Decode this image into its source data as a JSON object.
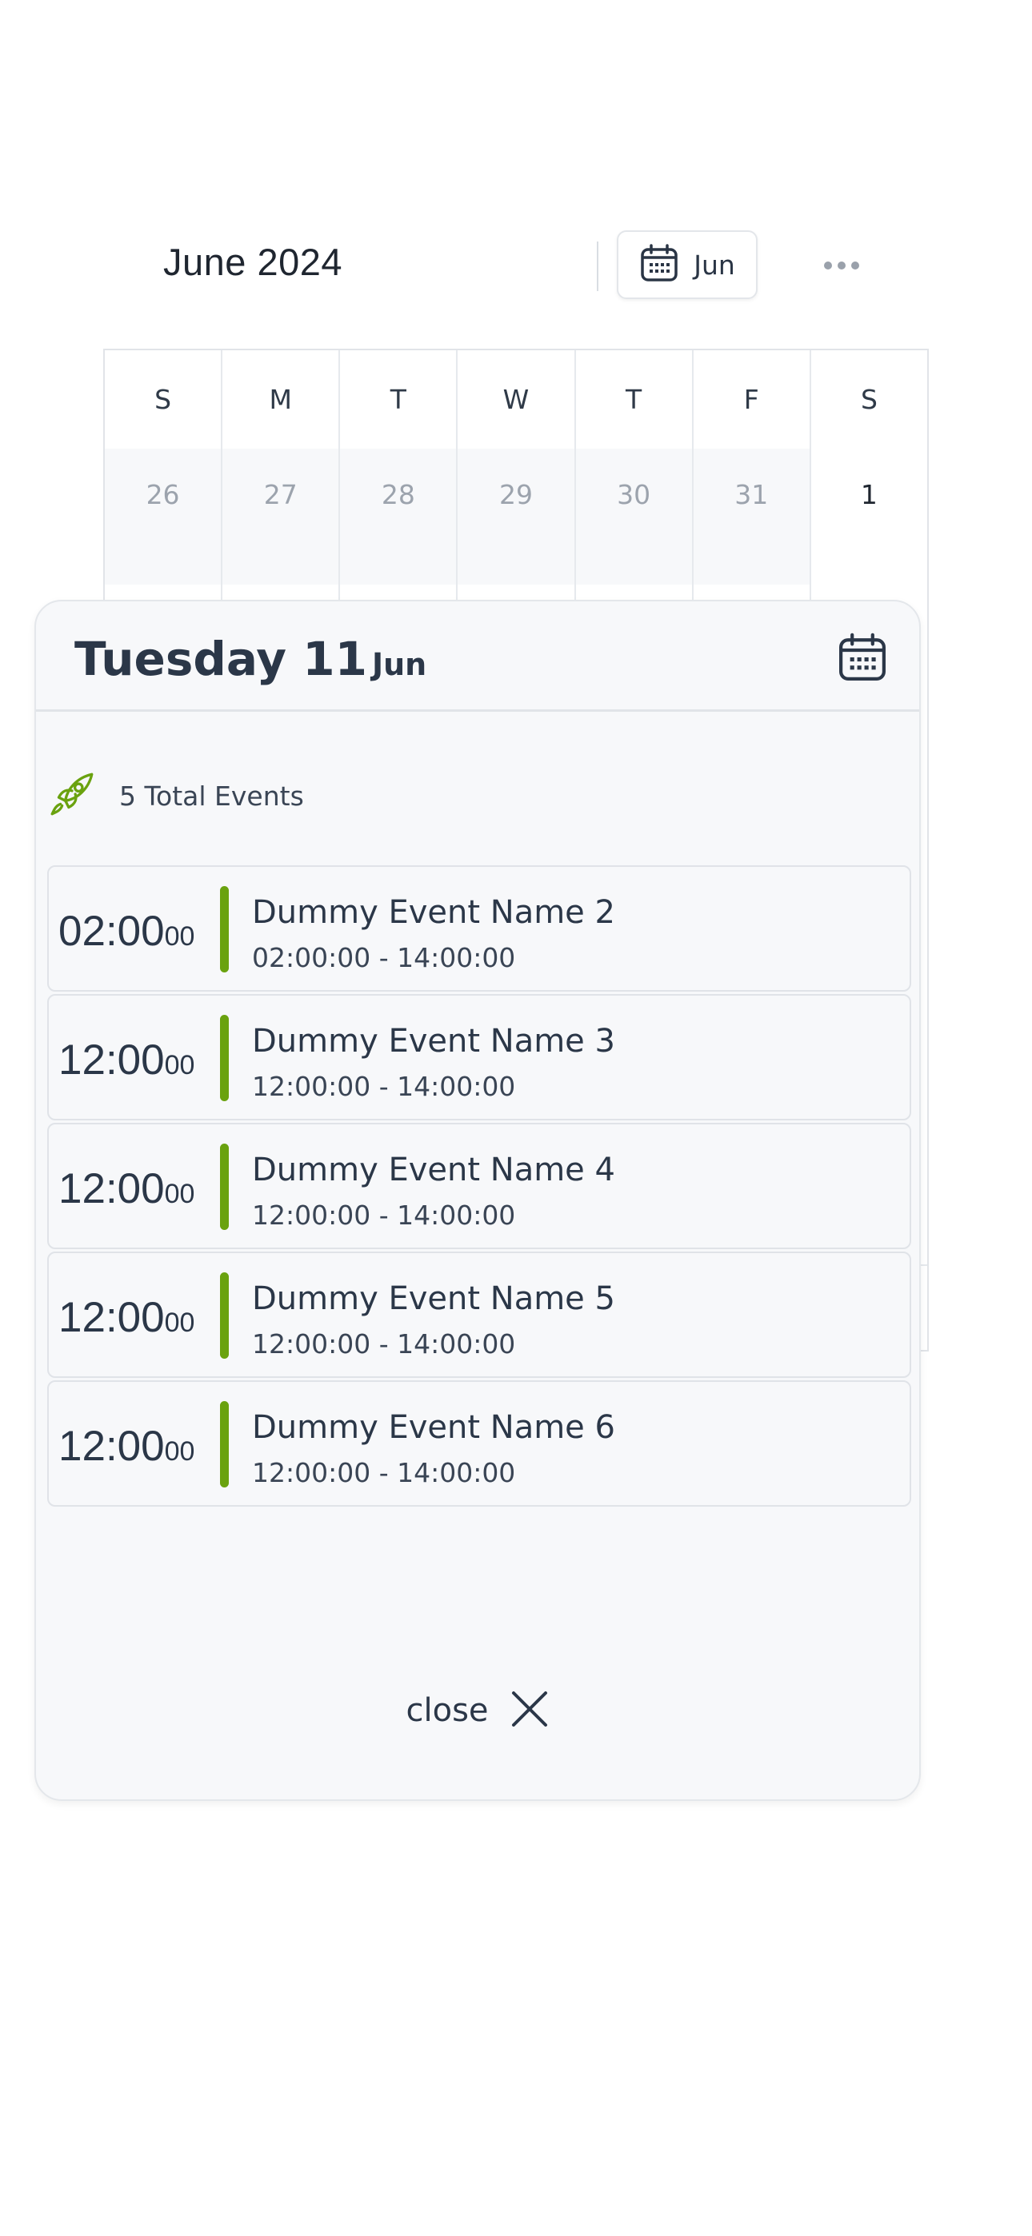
{
  "header": {
    "month_title": "June 2024",
    "view_button_label": "Jun",
    "more_icon": "more-horizontal-icon"
  },
  "calendar": {
    "weekdays": [
      "S",
      "M",
      "T",
      "W",
      "T",
      "F",
      "S"
    ],
    "first_week": [
      "26",
      "27",
      "28",
      "29",
      "30",
      "31",
      "1"
    ]
  },
  "modal": {
    "weekday_day": "Tuesday 11",
    "month": "Jun",
    "total_events": "5 Total Events",
    "events": [
      {
        "time_main": "02:00",
        "time_sec": "00",
        "name": "Dummy Event Name 2",
        "range": "02:00:00 - 14:00:00"
      },
      {
        "time_main": "12:00",
        "time_sec": "00",
        "name": "Dummy Event Name 3",
        "range": "12:00:00 - 14:00:00"
      },
      {
        "time_main": "12:00",
        "time_sec": "00",
        "name": "Dummy Event Name 4",
        "range": "12:00:00 - 14:00:00"
      },
      {
        "time_main": "12:00",
        "time_sec": "00",
        "name": "Dummy Event Name 5",
        "range": "12:00:00 - 14:00:00"
      },
      {
        "time_main": "12:00",
        "time_sec": "00",
        "name": "Dummy Event Name 6",
        "range": "12:00:00 - 14:00:00"
      }
    ],
    "close_label": "close"
  },
  "colors": {
    "accent_green": "#6aa20f",
    "text_dark": "#2b3748",
    "muted": "#9ca3ad"
  }
}
